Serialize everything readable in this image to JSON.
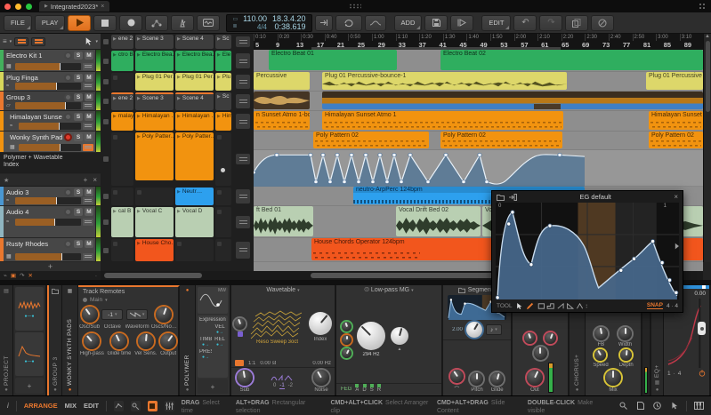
{
  "titlebar": {
    "tab": "Integrated2023*",
    "close": "×"
  },
  "transport": {
    "file": "FILE",
    "play": "PLAY",
    "tempo": "110.00",
    "sig": "4/4",
    "pos": "18.3.4.20",
    "time": "0:38.619",
    "add": "ADD",
    "edit": "EDIT",
    "undo": "↶",
    "redo": "↷"
  },
  "ui": {
    "s": "S",
    "m": "M",
    "plus": "+",
    "close": "×",
    "hamburger": "≡",
    "caret": "▾",
    "star": "★",
    "dot": "●"
  },
  "tracks": [
    {
      "name": "Electro Kit 1"
    },
    {
      "name": "Plug Finga"
    },
    {
      "name": "Group 3"
    },
    {
      "name": "Himalayan Sunset"
    },
    {
      "name": "Wonky Synth Pads"
    },
    {
      "name": "Audio 3"
    },
    {
      "name": "Audio 4"
    },
    {
      "name": "Rusty Rhodes"
    }
  ],
  "device_label": {
    "line1": "Polymer + Wavetable",
    "line2": "Index"
  },
  "launcher": {
    "scenes1": [
      "ene 2",
      "Scene 3",
      "Scene 4",
      "Sc"
    ],
    "scenes2": [
      "ene 2",
      "Scene 3",
      "Scene 4",
      "Sc"
    ],
    "electro": [
      "ctro Bea…",
      "Electro Bea…",
      "Electro Bea…",
      "Ele"
    ],
    "plug": [
      "Plug 01 Per…",
      "Plug 01 Per…",
      "Plu"
    ],
    "him": [
      "malayan …",
      "Himalayan …",
      "Himalayan …",
      "Him"
    ],
    "poly": [
      "Poly Patter…",
      "Poly Patter…"
    ],
    "neutro": "Neutr…",
    "vocal": [
      "cal B",
      "Vocal C",
      "Vocal D"
    ],
    "house": "House Cho…"
  },
  "ruler": {
    "times": [
      "0:10",
      "0:20",
      "0:30",
      "0:40",
      "0:50",
      "1:00",
      "1:10",
      "1:20",
      "1:30",
      "1:40",
      "1:50",
      "2:00",
      "2:10",
      "2:20",
      "2:30",
      "2:40",
      "2:50",
      "3:00",
      "3:10"
    ],
    "bars": [
      "5",
      "9",
      "13",
      "17",
      "21",
      "25",
      "29",
      "33",
      "37",
      "41",
      "45",
      "49",
      "53",
      "57",
      "61",
      "65",
      "69",
      "73",
      "77",
      "81",
      "85",
      "89"
    ]
  },
  "arr": {
    "green": [
      "Electro Beat 01",
      "Electro Beat 02"
    ],
    "plug": [
      "Percussive",
      "Plug 01 Percussive-bounce-1",
      "Plug 01 Percussive"
    ],
    "him": [
      "n Sunset Atmo 1-bounce-",
      "Himalayan Sunset Atmo 1",
      "Himalayan Sunset At…"
    ],
    "poly": [
      "Poly Pattern 02",
      "Poly Pattern 02",
      "Poly Pattern 02"
    ],
    "neutro": "neutro-ArpPerc 124bpm",
    "vocal": [
      "ft Bed 01",
      "Vocal Drift Bed 02",
      "Vo…"
    ],
    "house": "House Chords Operator 124bpm"
  },
  "popup": {
    "title": "EG default",
    "v0": "0",
    "v1": "1",
    "tool": "TOOL",
    "snap": "SNAP",
    "div1": "4",
    "divx": "·",
    "div2": "4",
    "close": "×"
  },
  "dev": {
    "project": "PROJECT",
    "group3": "GROUP 3",
    "wonky": "WONKY SYNTH PADS",
    "polymer": "POLYMER",
    "chorusplus": "CHORUS+",
    "eqplus": "EQ+",
    "remotes": {
      "title": "Track Remotes",
      "page": "Main",
      "octave_val": "-1",
      "k": [
        "Osc/Sub",
        "Octave",
        "Waveform",
        "Oscs/No…",
        "High-pass",
        "Glide time",
        "Vel Sens.",
        "Output"
      ]
    },
    "mw": "MW",
    "expr": {
      "title": "Expressions",
      "s": [
        "VEL",
        "TIMB",
        "REL",
        "PRES"
      ]
    },
    "wt": {
      "title": "Wavetable",
      "preset": "Reso Sweep 3oct",
      "index": "Index",
      "ratio": "1:1",
      "st": "0.00 st",
      "hz": "0.00 Hz",
      "sub": "Sub",
      "oct": [
        "0",
        "-1",
        "-2"
      ],
      "noise": "Noise"
    },
    "flt": {
      "title": "Low-pass MG",
      "freq": "294 Hz",
      "feg": "FEG",
      "adsr": [
        "A",
        "D",
        "S",
        "R"
      ]
    },
    "seg": {
      "title": "Segments",
      "val": "2.00",
      "note": "♪",
      "pitch": "Pitch",
      "glide": "Glide"
    },
    "out": "Out",
    "cho": {
      "fb": "FB",
      "width": "Width",
      "speed": "Speed",
      "depth": "Depth",
      "mix": "Mix"
    },
    "eq": {
      "val": "0.00",
      "a": "1",
      "x": "·",
      "b": "4"
    }
  },
  "statusbar": {
    "info": "i",
    "views": [
      "ARRANGE",
      "MIX",
      "EDIT"
    ],
    "hints": [
      {
        "k": "DRAG",
        "v": "Select time"
      },
      {
        "k": "ALT+DRAG",
        "v": "Rectangular selection"
      },
      {
        "k": "CMD+ALT+CLICK",
        "v": "Select Arranger clip"
      },
      {
        "k": "CMD+ALT+DRAG",
        "v": "Slide Content"
      },
      {
        "k": "DOUBLE-CLICK",
        "v": "Make visible"
      }
    ]
  }
}
